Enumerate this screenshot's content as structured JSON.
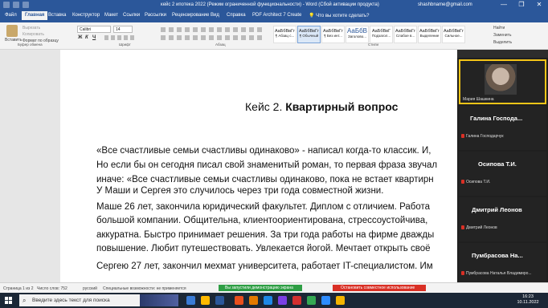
{
  "window": {
    "title": "кейс 2 ипотека 2022 (Режим ограниченной функциональности) - Word (Сбой активации продукта)",
    "user_email": "shashbname@gmail.com",
    "controls": [
      "—",
      "❐",
      "✕"
    ]
  },
  "ribbon_tabs": [
    "Файл",
    "Главная",
    "Вставка",
    "Конструктор",
    "Макет",
    "Ссылки",
    "Рассылки",
    "Рецензирование",
    "Вид",
    "Справка",
    "PDF Architect 7 Create"
  ],
  "tell_me": "Что вы хотите сделать?",
  "clipboard": {
    "paste_label": "Вставить",
    "cut_label": "Вырезать",
    "copy_label": "Копировать",
    "format_painter_label": "Формат по образцу",
    "group_label": "Буфер обмена"
  },
  "font": {
    "name": "Calibri",
    "size": "14",
    "group_label": "Шрифт",
    "buttons": [
      "Ж",
      "К",
      "Ч"
    ]
  },
  "paragraph_group_label": "Абзац",
  "styles": {
    "items": [
      {
        "sample": "АаБбВвГг",
        "label": "¶ Абзац с..."
      },
      {
        "sample": "АаБбВвГг",
        "label": "¶ Обычный"
      },
      {
        "sample": "АаБбВвГг",
        "label": "¶ Без инт..."
      },
      {
        "sample": "АаБбВ",
        "label": "Заголово..."
      },
      {
        "sample": "АаБбВвГ",
        "label": "Подзагол..."
      },
      {
        "sample": "АаБбВвГг",
        "label": "Слабое в..."
      },
      {
        "sample": "АаБбВвГг",
        "label": "Выделение"
      },
      {
        "sample": "АаБбВвГг",
        "label": "Сильное..."
      }
    ],
    "group_label": "Стили"
  },
  "editing": {
    "find_label": "Найти",
    "replace_label": "Заменить",
    "select_label": "Выделить",
    "group_label": "Редактирование"
  },
  "document": {
    "heading_prefix": "Кейс 2. ",
    "heading_bold": "Квартирный вопрос",
    "lines": [
      "«Все счастливые семьи счастливы одинаково» - написал когда-то классик. И, ",
      "Но если бы он сегодня писал свой знаменитый роман, то первая фраза звучал",
      "иначе: «Все счастливые семьи счастливы одинаково, пока не встает квартирн",
      "У Маши и Сергея это случилось через три года совместной жизни.",
      "Маше 26 лет, закончила юридический факультет. Диплом с отличием. Работа",
      "большой компании. Общительна, клиентоориентирована, стрессоустойчива,",
      "аккуратна. Быстро принимает решения. За три года работы на фирме дважды",
      "повышение. Любит путешествовать. Увлекается йогой. Мечтает открыть своё",
      "Сергею 27 лет, закончил мехмат университета, работает IT-специалистом. Им"
    ]
  },
  "zoom_panel": {
    "participants": [
      {
        "display": "Мария Шашкина",
        "sub": ""
      },
      {
        "display": "Галина  Господа...",
        "sub": "Галина Господарчук"
      },
      {
        "display": "Осипова Т.И.",
        "sub": "Осипова Т.И."
      },
      {
        "display": "Дмитрий Леонов",
        "sub": "Дмитрий Леонов"
      },
      {
        "display": "Пумбрасова  На...",
        "sub": "Пумбрасова Наталья Владимиро..."
      }
    ]
  },
  "status_bar": {
    "page": "Страница 1 из 2",
    "words": "Число слов: 752",
    "language": "русский",
    "accessibility": "Специальные возможности: не применяется",
    "sharing": "Вы запустили демонстрацию экрана",
    "stop_sharing": "Остановить совместное использование"
  },
  "taskbar": {
    "search_placeholder": "Введите здесь текст для поиска",
    "time": "16:23",
    "date": "10.11.2022",
    "icon_colors": [
      "#3a7bd5",
      "#ffb900",
      "#2b579a",
      "#e94f1d",
      "#e37a00",
      "#1e88e5",
      "#7b3fe4",
      "#d32f2f",
      "#34a853",
      "#2d8cff",
      "#f4b400"
    ]
  }
}
